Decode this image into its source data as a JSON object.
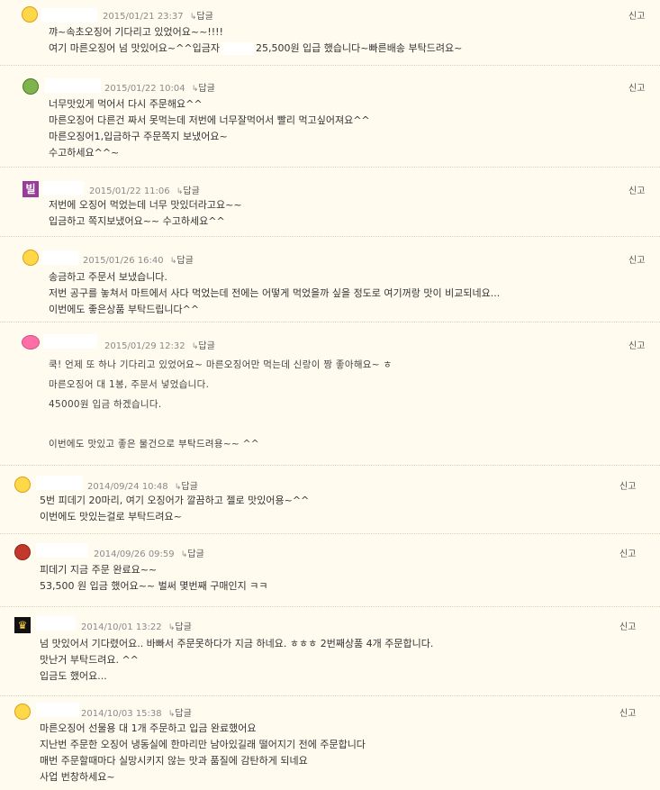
{
  "reply_label": "답글",
  "report_label": "신고",
  "icons": {
    "reply_arrow": "arrow-icon"
  },
  "comments": [
    {
      "date": "2015/01/21 23:37",
      "avatar": "smiley-face-icon",
      "lines": [
        "꺄~속초오징어 기다리고 있었어요~~!!!!",
        "여기 마른오징어 넘 맛있어요~^^입금자",
        "25,500원 입급 했습니다~빠른배송 부탁드려요~"
      ]
    },
    {
      "date": "2015/01/22 10:04",
      "avatar": "frog-icon",
      "lines": [
        "너무맛있게 먹어서 다시 주문해요^^",
        "마른오징어 다른건 짜서 못먹는데 저번에 너무잘먹어서 빨리 먹고싶어져요^^",
        "마른오징어1,입금하구 주문쪽지 보냈어요~",
        "수고하세요^^~"
      ]
    },
    {
      "date": "2015/01/22 11:06",
      "avatar": "bil-icon",
      "avatar_text": "빌",
      "lines": [
        "저번에 오징어 먹었는데 너무 맛있더라고요~~",
        "입금하고 쪽지보냈어요~~ 수고하세요^^"
      ]
    },
    {
      "date": "2015/01/26 16:40",
      "avatar": "smiley-face-icon",
      "lines": [
        "송금하고 주문서 보냈습니다.",
        "저번 공구를 놓쳐서 마트에서 사다 먹었는데 전에는 어떻게 먹었을까 싶을 정도로 여기꺼랑 맛이 비교되네요...",
        "이번에도 좋은상품 부탁드립니다^^"
      ]
    },
    {
      "date": "2015/01/29 12:32",
      "avatar": "pig-icon",
      "lines": [
        "쿡! 언제 또 하나 기다리고 있었어요~ 마른오징어만 먹는데 신랑이 짱 좋아해요~ ㅎ",
        "마른오징어 대 1봉, 주문서 넣었습니다.",
        "45000원 입금 하겠습니다.",
        "",
        "이번에도 맛있고 좋은 물건으로 부탁드려용~~ ^^"
      ]
    },
    {
      "date": "2014/09/24 10:48",
      "avatar": "smiley-face-icon",
      "lines": [
        "5번 피데기 20마리, 여기 오징어가 깔끔하고 젤로 맛있어용~^^",
        "이번에도 맛있는걸로 부탁드려요~"
      ]
    },
    {
      "date": "2014/09/26 09:59",
      "avatar": "red-character-icon",
      "lines": [
        "피데기 지금 주문 완료요~~",
        "53,500 원 입금 했어요~~ 벌써 몇번째 구매인지 ㅋㅋ"
      ]
    },
    {
      "date": "2014/10/01 13:22",
      "avatar": "crown-icon",
      "lines": [
        "넘 맛있어서 기다렸어요.. 바빠서 주문못하다가 지금 하네요. ㅎㅎㅎ 2번째상품 4개 주문합니다.",
        "맛난거 부탁드려요. ^^",
        "입금도 했어요..."
      ]
    },
    {
      "date": "2014/10/03 15:38",
      "avatar": "smiley-face-icon",
      "lines": [
        "마른오징어 선물용 대 1개 주문하고 입금 완료했어요",
        "지난번 주문한 오징어 냉동실에 한마리만 남아있길래 떨어지기 전에 주문합니다",
        "매번 주문할때마다 실망시키지 않는 맛과 품질에 감탄하게 되네요",
        "사업 번창하세요~"
      ]
    }
  ]
}
